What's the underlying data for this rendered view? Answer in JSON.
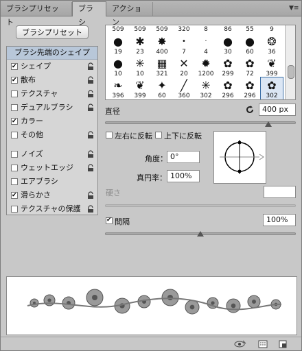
{
  "tabs": [
    {
      "label": "ブラシプリセット"
    },
    {
      "label": "ブラシ"
    },
    {
      "label": "アクション"
    }
  ],
  "preset_button_label": "ブラシプリセット",
  "settings": {
    "header": "ブラシ先端のシェイプ",
    "items": [
      {
        "label": "シェイプ",
        "checked": true
      },
      {
        "label": "散布",
        "checked": true
      },
      {
        "label": "テクスチャ",
        "checked": false
      },
      {
        "label": "デュアルブラシ",
        "checked": false
      },
      {
        "label": "カラー",
        "checked": true
      },
      {
        "label": "その他",
        "checked": false
      },
      {
        "label": "ノイズ",
        "checked": false
      },
      {
        "label": "ウェットエッジ",
        "checked": false
      },
      {
        "label": "エアブラシ",
        "checked": false
      },
      {
        "label": "滑らかさ",
        "checked": true
      },
      {
        "label": "テクスチャの保護",
        "checked": false
      }
    ]
  },
  "brush_tips": {
    "top_row_sizes": [
      "509",
      "509",
      "509",
      "320",
      "8",
      "86",
      "55",
      "9"
    ],
    "rows": [
      [
        {
          "size": "19"
        },
        {
          "size": "23"
        },
        {
          "size": "400"
        },
        {
          "size": "7"
        },
        {
          "size": "4"
        },
        {
          "size": "30"
        },
        {
          "size": "60"
        },
        {
          "size": "36"
        }
      ],
      [
        {
          "size": "10"
        },
        {
          "size": "10"
        },
        {
          "size": "321"
        },
        {
          "size": "20"
        },
        {
          "size": "1200"
        },
        {
          "size": "299"
        },
        {
          "size": "72"
        },
        {
          "size": "399"
        }
      ],
      [
        {
          "size": "396"
        },
        {
          "size": "399"
        },
        {
          "size": "60"
        },
        {
          "size": "360"
        },
        {
          "size": "302"
        },
        {
          "size": "296"
        },
        {
          "size": "296"
        },
        {
          "size": "302"
        }
      ]
    ]
  },
  "diameter": {
    "label": "直径",
    "value": "400 px"
  },
  "flip_x_label": "左右に反転",
  "flip_y_label": "上下に反転",
  "angle": {
    "label": "角度：",
    "value": "0°"
  },
  "roundness": {
    "label": "真円率：",
    "value": "100%"
  },
  "hardness_label": "硬さ",
  "spacing": {
    "label": "間隔",
    "value": "100%",
    "checked": true
  },
  "colors": {
    "accent": "#3a6ea5",
    "panel": "#c8c8c8"
  }
}
